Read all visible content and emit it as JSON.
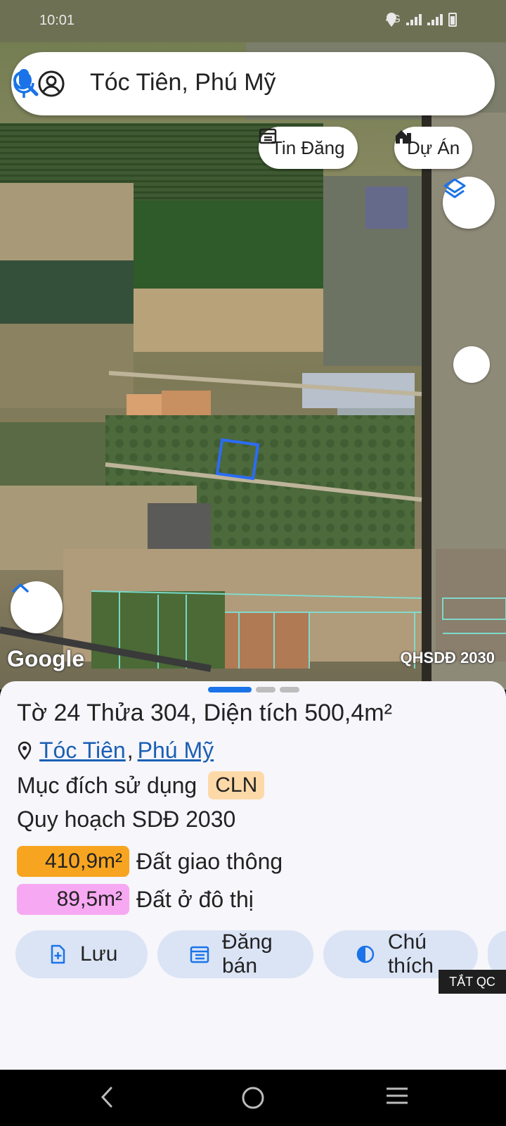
{
  "status_bar": {
    "time": "10:01",
    "network": "4G"
  },
  "search": {
    "query": "Tóc Tiên, Phú Mỹ"
  },
  "chips": {
    "listings": "Tin Đăng",
    "projects": "Dự Án"
  },
  "map": {
    "watermark": "Google",
    "plan_label": "QHSDĐ 2030"
  },
  "parcel": {
    "title": "Tờ 24 Thửa 304, Diện tích 500,4m²",
    "ward": "Tóc Tiên",
    "separator": ",",
    "city": "Phú Mỹ",
    "purpose_label": "Mục đích sử dụng",
    "purpose_code": "CLN",
    "plan_title": "Quy hoạch SDĐ 2030",
    "areas": [
      {
        "value": "410,9m²",
        "label": "Đất giao thông",
        "color": "#f7a521"
      },
      {
        "value": "89,5m²",
        "label": "Đất ở đô thị",
        "color": "#f7a8f2"
      }
    ]
  },
  "actions": {
    "save": "Lưu",
    "post": "Đăng bán",
    "legend": "Chú thích"
  },
  "ad": {
    "close_label": "TẮT QC"
  },
  "colors": {
    "accent": "#1a73e8",
    "button_bg": "#dbe4f5",
    "sheet_bg": "#f6f6fb"
  }
}
